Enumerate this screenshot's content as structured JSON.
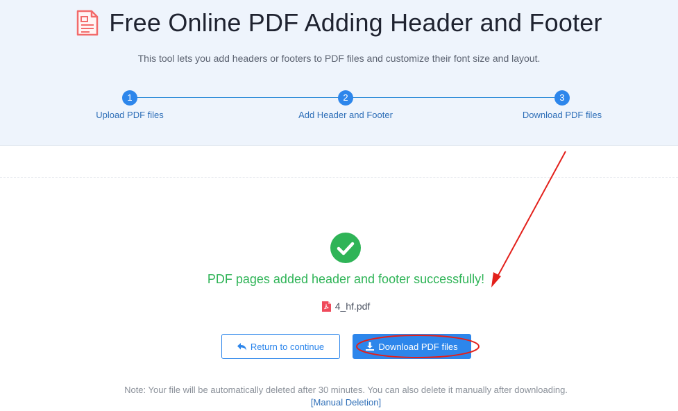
{
  "header": {
    "title": "Free Online PDF Adding Header and Footer",
    "subtitle": "This tool lets you add headers or footers to PDF files and customize their font size and layout."
  },
  "steps": [
    {
      "number": "1",
      "label": "Upload PDF files"
    },
    {
      "number": "2",
      "label": "Add Header and Footer"
    },
    {
      "number": "3",
      "label": "Download PDF files"
    }
  ],
  "result": {
    "message": "PDF pages added header and footer successfully!",
    "file_name": "4_hf.pdf"
  },
  "buttons": {
    "return_label": "Return to continue",
    "download_label": "Download PDF files"
  },
  "note": {
    "text": "Note: Your file will be automatically deleted after 30 minutes. You can also delete it manually after downloading.",
    "manual_link": "[Manual Deletion]"
  },
  "icons": {
    "title": "pdf-document-icon",
    "success": "check-circle-icon",
    "file": "pdf-file-icon",
    "return": "return-arrow-icon",
    "download": "download-icon"
  },
  "colors": {
    "accent": "#2d86eb",
    "success": "#2fb457",
    "title_icon": "#f26b6b",
    "annotation": "#e3201b"
  }
}
